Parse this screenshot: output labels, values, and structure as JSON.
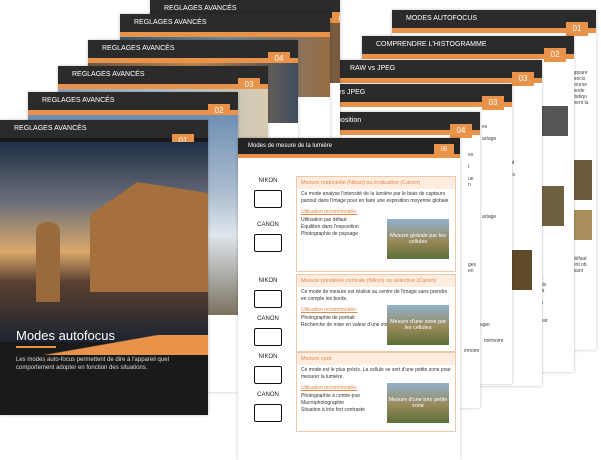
{
  "cards": {
    "c1": {
      "title": "REGLAGES AVANCÉS",
      "num": "05"
    },
    "c2": {
      "title": "REGLAGES AVANCÉS",
      "num": "05"
    },
    "c3": {
      "title": "REGLAGES AVANCÉS",
      "num": "04"
    },
    "c4": {
      "title": "REGLAGES AVANCÉS",
      "num": "03"
    },
    "c5": {
      "title": "REGLAGES AVANCÉS",
      "num": "02"
    },
    "c6": {
      "title": "REGLAGES AVANCÉS",
      "num": "01"
    },
    "r1": {
      "title": "MODES AUTOFOCUS",
      "num": "01"
    },
    "r2": {
      "title": "COMPRENDRE L'HISTOGRAMME",
      "num": "02"
    },
    "r3": {
      "title": "RAW vs JPEG",
      "num": "03"
    },
    "r4": {
      "title": "RAW vs JPEG",
      "num": "03"
    },
    "r5": {
      "title": "La correction d'exposition",
      "num": "04"
    }
  },
  "front": {
    "title": "Modes autofocus",
    "desc": "Les modes auto-focus permettent de dire à l'appareil quel comportement adopter en fonction des situations."
  },
  "modes": {
    "title": "Modes de mesure de la lumière",
    "num": "05",
    "sections": [
      {
        "nikon": "NIKON",
        "canon": "CANON",
        "title": "Mesure matricielle (Nikon) ou évaluative (Canon)",
        "text": "Ce mode analyse l'intensité de la lumière par le biais de capteurs partout dans l'image pour en faire une exposition moyenne globale",
        "usage": "Utilisation recommandée:",
        "items": [
          "Utilisation par défaut",
          "Equilibre dans l'exposition",
          "Photographie de paysage"
        ],
        "thumb": "Mesure globale par les cellules"
      },
      {
        "nikon": "NIKON",
        "canon": "CANON",
        "title": "Mesure pondérée centrale (Nikon) ou sélective (Canon)",
        "text": "Ce mode de mesure est réalisé au centre de l'image sans prendre en compte les bords.",
        "usage": "Utilisation recommandée:",
        "items": [
          "Photographie de portrait",
          "Recherche de mise en valeur d'une zone particulière"
        ],
        "thumb": "Mesure d'une zone par les cellules"
      },
      {
        "nikon": "NIKON",
        "canon": "CANON",
        "title": "Mesure spot",
        "text": "Ce mode est le plus précis. La cellule se sert d'une petite zone pour mesurer la lumière.",
        "usage": "Utilisation recommandée:",
        "items": [
          "Photographie à contre-jour",
          "Macrophotographie",
          "Situation à très fort contraste"
        ],
        "thumb": "Mesure d'une très petite zone"
      }
    ]
  },
  "fragments": {
    "a": "ager",
    "b": "mémoire",
    "c": "ager",
    "d": "émoire"
  }
}
